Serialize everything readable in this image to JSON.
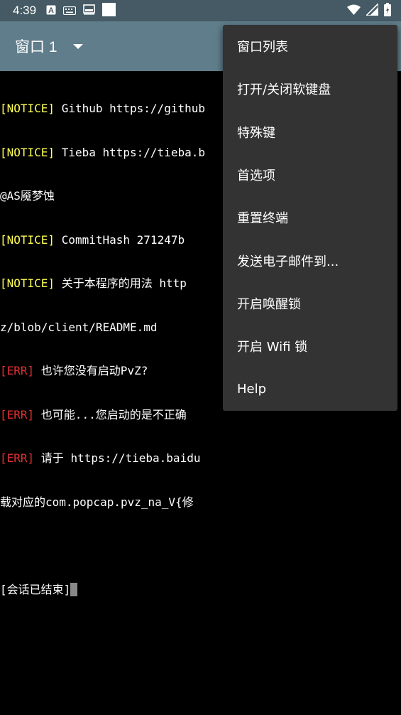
{
  "status_bar": {
    "time": "4:39",
    "left_icons": [
      "font-a-icon",
      "keyboard-icon",
      "screen-icon",
      "square-icon"
    ],
    "right_icons": [
      "wifi-icon",
      "signal-icon",
      "battery-icon"
    ]
  },
  "app_bar": {
    "window_title": "窗口 1"
  },
  "terminal": {
    "lines": [
      {
        "tag": "[NOTICE]",
        "type": "notice",
        "text": " Github https://github"
      },
      {
        "tag": "[NOTICE]",
        "type": "notice",
        "text": " Tieba https://tieba.b"
      },
      {
        "tag": "",
        "type": "plain",
        "text": "@AS魇梦蚀"
      },
      {
        "tag": "[NOTICE]",
        "type": "notice",
        "text": " CommitHash 271247b"
      },
      {
        "tag": "[NOTICE]",
        "type": "notice",
        "text": " 关于本程序的用法 http"
      },
      {
        "tag": "",
        "type": "plain",
        "text": "z/blob/client/README.md"
      },
      {
        "tag": "[ERR]",
        "type": "err",
        "text": " 也许您没有启动PvZ?"
      },
      {
        "tag": "[ERR]",
        "type": "err",
        "text": " 也可能...您启动的是不正确"
      },
      {
        "tag": "[ERR]",
        "type": "err",
        "text": " 请于 https://tieba.baidu"
      },
      {
        "tag": "",
        "type": "plain",
        "text": "载对应的com.popcap.pvz_na_V{修"
      },
      {
        "tag": "",
        "type": "plain",
        "text": ""
      },
      {
        "tag": "",
        "type": "plain",
        "text": "[会话已结束]"
      }
    ]
  },
  "menu": {
    "items": [
      {
        "id": "window-list",
        "label": "窗口列表"
      },
      {
        "id": "toggle-soft-keyboard",
        "label": "打开/关闭软键盘"
      },
      {
        "id": "special-keys",
        "label": "特殊键"
      },
      {
        "id": "preferences",
        "label": "首选项"
      },
      {
        "id": "reset-terminal",
        "label": "重置终端"
      },
      {
        "id": "send-email",
        "label": "发送电子邮件到..."
      },
      {
        "id": "wake-lock",
        "label": "开启唤醒锁"
      },
      {
        "id": "wifi-lock",
        "label": "开启 Wifi 锁"
      },
      {
        "id": "help",
        "label": "Help"
      }
    ]
  }
}
